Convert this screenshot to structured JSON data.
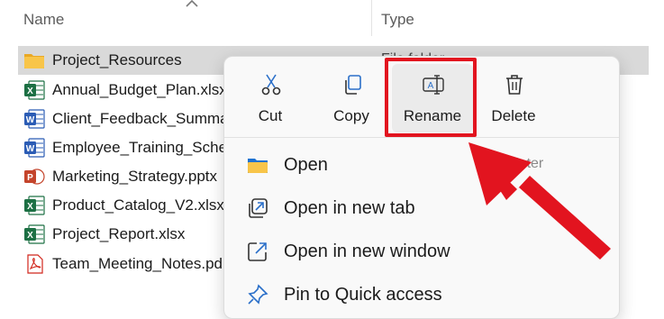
{
  "header": {
    "name_label": "Name",
    "type_label": "Type"
  },
  "files": [
    {
      "name": "Project_Resources",
      "icon": "folder-icon",
      "type": "File folder",
      "selected": true
    },
    {
      "name": "Annual_Budget_Plan.xlsx",
      "icon": "excel-file-icon"
    },
    {
      "name": "Client_Feedback_Summa",
      "icon": "word-file-icon"
    },
    {
      "name": "Employee_Training_Sche",
      "icon": "word-file-icon"
    },
    {
      "name": "Marketing_Strategy.pptx",
      "icon": "powerpoint-file-icon"
    },
    {
      "name": "Product_Catalog_V2.xlsx",
      "icon": "excel-file-icon"
    },
    {
      "name": "Project_Report.xlsx",
      "icon": "excel-file-icon"
    },
    {
      "name": "Team_Meeting_Notes.pd",
      "icon": "pdf-file-icon"
    }
  ],
  "context_menu": {
    "quick_actions": [
      {
        "label": "Cut",
        "icon": "scissors-icon"
      },
      {
        "label": "Copy",
        "icon": "copy-icon"
      },
      {
        "label": "Rename",
        "icon": "rename-icon"
      },
      {
        "label": "Delete",
        "icon": "trash-icon"
      }
    ],
    "items": [
      {
        "label": "Open",
        "icon": "folder-open-icon",
        "shortcut": "Enter"
      },
      {
        "label": "Open in new tab",
        "icon": "new-tab-icon"
      },
      {
        "label": "Open in new window",
        "icon": "new-window-icon"
      },
      {
        "label": "Pin to Quick access",
        "icon": "pin-icon"
      }
    ]
  },
  "partial_text": {
    "behind_menu_right": "n"
  },
  "colors": {
    "annotation": "#e2141f",
    "selected_row": "#d9d9d9",
    "folder": "#f4b93c",
    "excel": "#1d7044",
    "word": "#2b5cb5",
    "powerpoint": "#c4442b",
    "pdf": "#d1261c"
  }
}
